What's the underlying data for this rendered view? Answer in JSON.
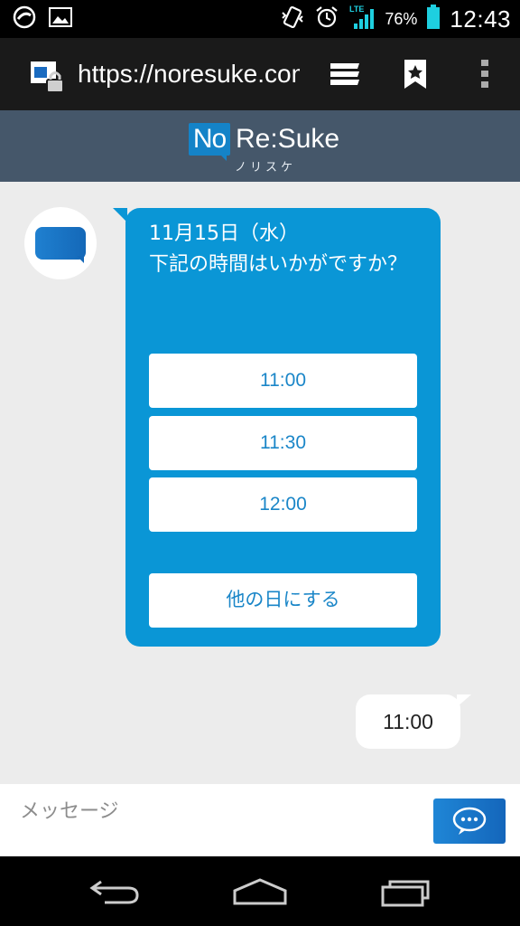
{
  "status_bar": {
    "battery_percent": "76%",
    "network": "LTE",
    "time": "12:43"
  },
  "browser": {
    "url": "https://noresuke.com"
  },
  "site": {
    "logo_no": "No",
    "logo_re": "Re:Suke",
    "logo_kana": "ノリスケ"
  },
  "chat": {
    "bot_message": {
      "line1": "11月15日（水）",
      "line2": "下記の時間はいかがですか？",
      "choices": [
        "11:00",
        "11:30",
        "12:00"
      ],
      "other_day": "他の日にする"
    },
    "user_message": "11:00"
  },
  "composer": {
    "placeholder": "メッセージ"
  },
  "colors": {
    "header": "#45576a",
    "bubble": "#0a96d6",
    "choice_text": "#1a86c8",
    "chat_bg": "#ececec"
  }
}
